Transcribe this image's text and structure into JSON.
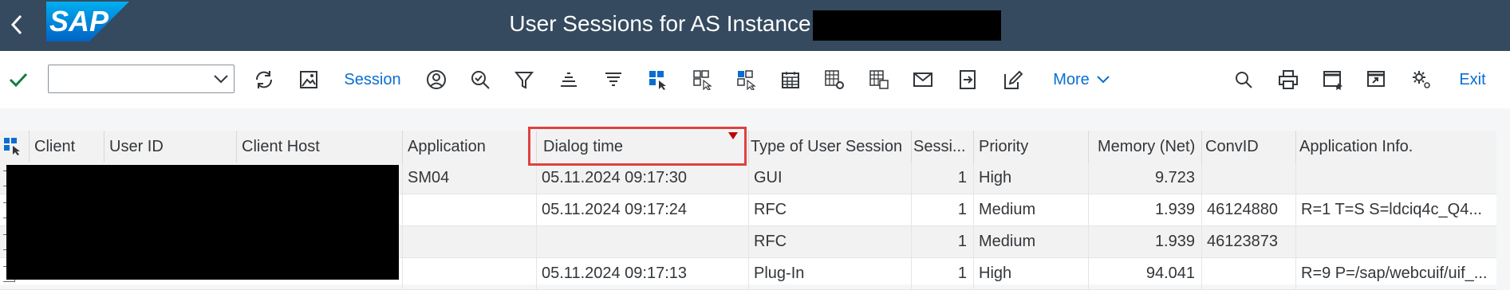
{
  "header": {
    "title": "User Sessions for AS Instance",
    "logo_text": "SAP",
    "back_icon": "chevron-left-icon"
  },
  "toolbar": {
    "session_label": "Session",
    "more_label": "More",
    "exit_label": "Exit",
    "combo_value": ""
  },
  "table": {
    "columns": [
      "Client",
      "User ID",
      "Client Host",
      "Application",
      "Dialog time",
      "Type of User Session",
      "Sessi...",
      "Priority",
      "Memory (Net)",
      "ConvID",
      "Application Info."
    ],
    "sorted_column": "Dialog time",
    "rows": [
      {
        "application": "SM04",
        "dialog_time": "05.11.2024 09:17:30",
        "type": "GUI",
        "sessions": "1",
        "priority": "High",
        "memory": "9.723",
        "convid": "",
        "info": ""
      },
      {
        "application": "",
        "dialog_time": "05.11.2024 09:17:24",
        "type": "RFC",
        "sessions": "1",
        "priority": "Medium",
        "memory": "1.939",
        "convid": "46124880",
        "info": "R=1 T=S S=ldciq4c_Q4..."
      },
      {
        "application": "",
        "dialog_time": "",
        "type": "RFC",
        "sessions": "1",
        "priority": "Medium",
        "memory": "1.939",
        "convid": "46123873",
        "info": ""
      },
      {
        "application": "",
        "dialog_time": "05.11.2024 09:17:13",
        "type": "Plug-In",
        "sessions": "1",
        "priority": "High",
        "memory": "94.041",
        "convid": "",
        "info": "R=9 P=/sap/webcuif/uif_..."
      }
    ]
  },
  "colors": {
    "header_bg": "#354a5f",
    "accent": "#0a6ed1",
    "check": "#107e3e",
    "highlight": "#e04040"
  }
}
